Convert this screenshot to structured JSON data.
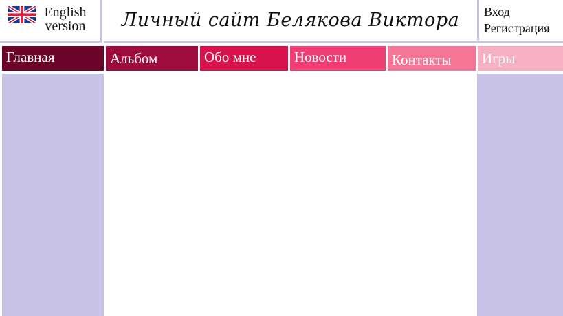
{
  "language": {
    "line1": "English",
    "line2": "version",
    "flag_icon": "uk-flag-icon"
  },
  "header": {
    "title": "Личный сайт Белякова Виктора"
  },
  "auth": {
    "login": "Вход",
    "register": "Регистрация"
  },
  "nav": {
    "items": [
      {
        "label": "Главная",
        "color": "#6b0428"
      },
      {
        "label": "Альбом",
        "color": "#9d0c3d"
      },
      {
        "label": "Обо мне",
        "color": "#d8124d"
      },
      {
        "label": "Новости",
        "color": "#f03d74"
      },
      {
        "label": "Контакты",
        "color": "#f47596"
      },
      {
        "label": "Игры",
        "color": "#f7afc3"
      }
    ]
  },
  "colors": {
    "sidebar": "#c8c2e6",
    "background": "#ffffff"
  }
}
